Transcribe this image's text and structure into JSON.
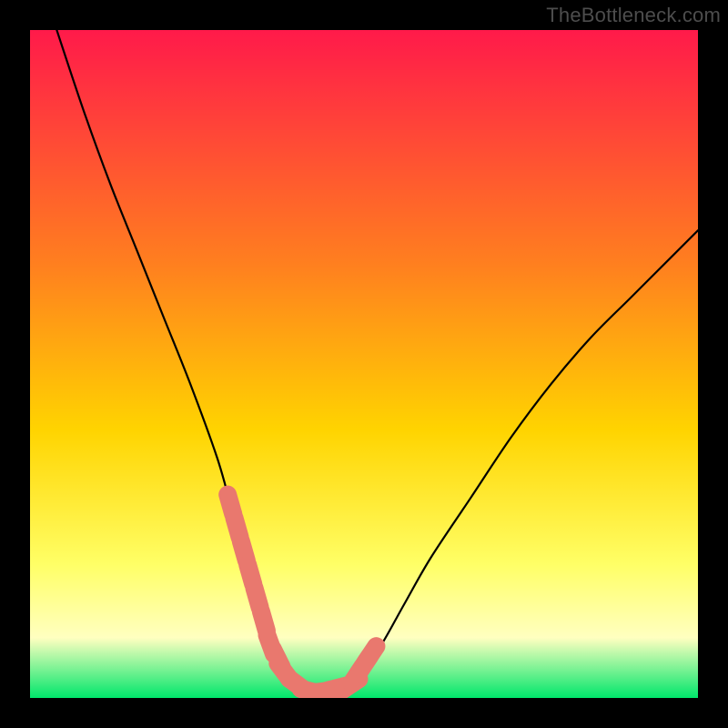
{
  "watermark": "TheBottleneck.com",
  "colors": {
    "frame": "#000000",
    "gradient_top": "#ff1a4a",
    "gradient_mid1": "#ff7f1f",
    "gradient_mid2": "#ffd400",
    "gradient_mid3": "#ffff66",
    "gradient_pale": "#ffffc0",
    "gradient_bottom": "#00e66b",
    "curve": "#000000",
    "marker": "#e9786e"
  },
  "chart_data": {
    "type": "line",
    "title": "",
    "xlabel": "",
    "ylabel": "",
    "xlim": [
      0,
      100
    ],
    "ylim": [
      0,
      100
    ],
    "series": [
      {
        "name": "bottleneck-curve",
        "x": [
          4,
          8,
          12,
          16,
          20,
          24,
          28,
          30,
          32,
          34,
          36,
          38,
          40,
          42,
          44,
          48,
          52,
          56,
          60,
          66,
          72,
          78,
          84,
          90,
          96,
          100
        ],
        "y": [
          100,
          88,
          77,
          67,
          57,
          47,
          36,
          29,
          22,
          15,
          8,
          4,
          2,
          1,
          1,
          2,
          7,
          14,
          21,
          30,
          39,
          47,
          54,
          60,
          66,
          70
        ]
      }
    ],
    "markers": {
      "name": "highlight-segments",
      "x": [
        30,
        31,
        32,
        33,
        34,
        35,
        36,
        37,
        38,
        40,
        42,
        44,
        46,
        48,
        49,
        50,
        51
      ],
      "y": [
        29,
        25.5,
        22,
        18.5,
        15,
        11.5,
        8,
        6,
        4,
        2,
        1,
        1,
        1.5,
        2,
        3.5,
        5,
        6.5
      ]
    }
  }
}
